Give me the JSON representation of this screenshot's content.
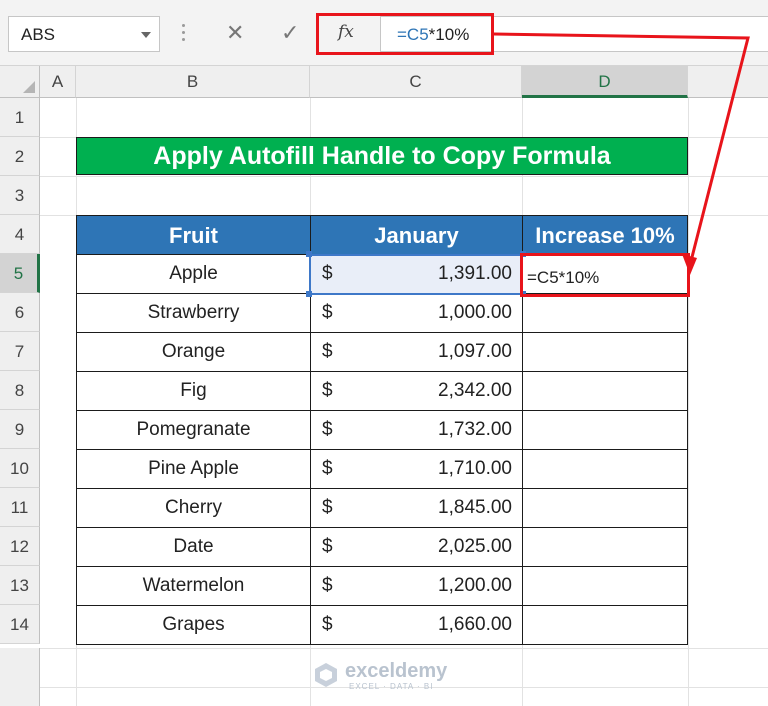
{
  "formula_bar": {
    "name_box": "ABS",
    "cancel_symbol": "✕",
    "enter_symbol": "✓",
    "fx_label": "fx",
    "formula": "=C5*10%"
  },
  "columns": [
    "A",
    "B",
    "C",
    "D"
  ],
  "rows": [
    "1",
    "2",
    "3",
    "4",
    "5",
    "6",
    "7",
    "8",
    "9",
    "10",
    "11",
    "12",
    "13",
    "14"
  ],
  "sheet": {
    "title": "Apply Autofill Handle to Copy Formula",
    "headers": {
      "fruit": "Fruit",
      "january": "January",
      "increase": "Increase 10%"
    },
    "currency_symbol": "$",
    "data": [
      {
        "fruit": "Apple",
        "january": "1,391.00"
      },
      {
        "fruit": "Strawberry",
        "january": "1,000.00"
      },
      {
        "fruit": "Orange",
        "january": "1,097.00"
      },
      {
        "fruit": "Fig",
        "january": "2,342.00"
      },
      {
        "fruit": "Pomegranate",
        "january": "1,732.00"
      },
      {
        "fruit": "Pine Apple",
        "january": "1,710.00"
      },
      {
        "fruit": "Cherry",
        "january": "1,845.00"
      },
      {
        "fruit": "Date",
        "january": "2,025.00"
      },
      {
        "fruit": "Watermelon",
        "january": "1,200.00"
      },
      {
        "fruit": "Grapes",
        "january": "1,660.00"
      }
    ],
    "editing_cell_text": "=C5*10%"
  },
  "watermark": {
    "brand": "exceldemy",
    "tagline": "EXCEL · DATA · BI"
  },
  "colors": {
    "title_bg": "#00b050",
    "header_bg": "#2e75b6",
    "highlight_red": "#e8141b",
    "selection_blue": "#3e78c8",
    "excel_green": "#217346"
  }
}
